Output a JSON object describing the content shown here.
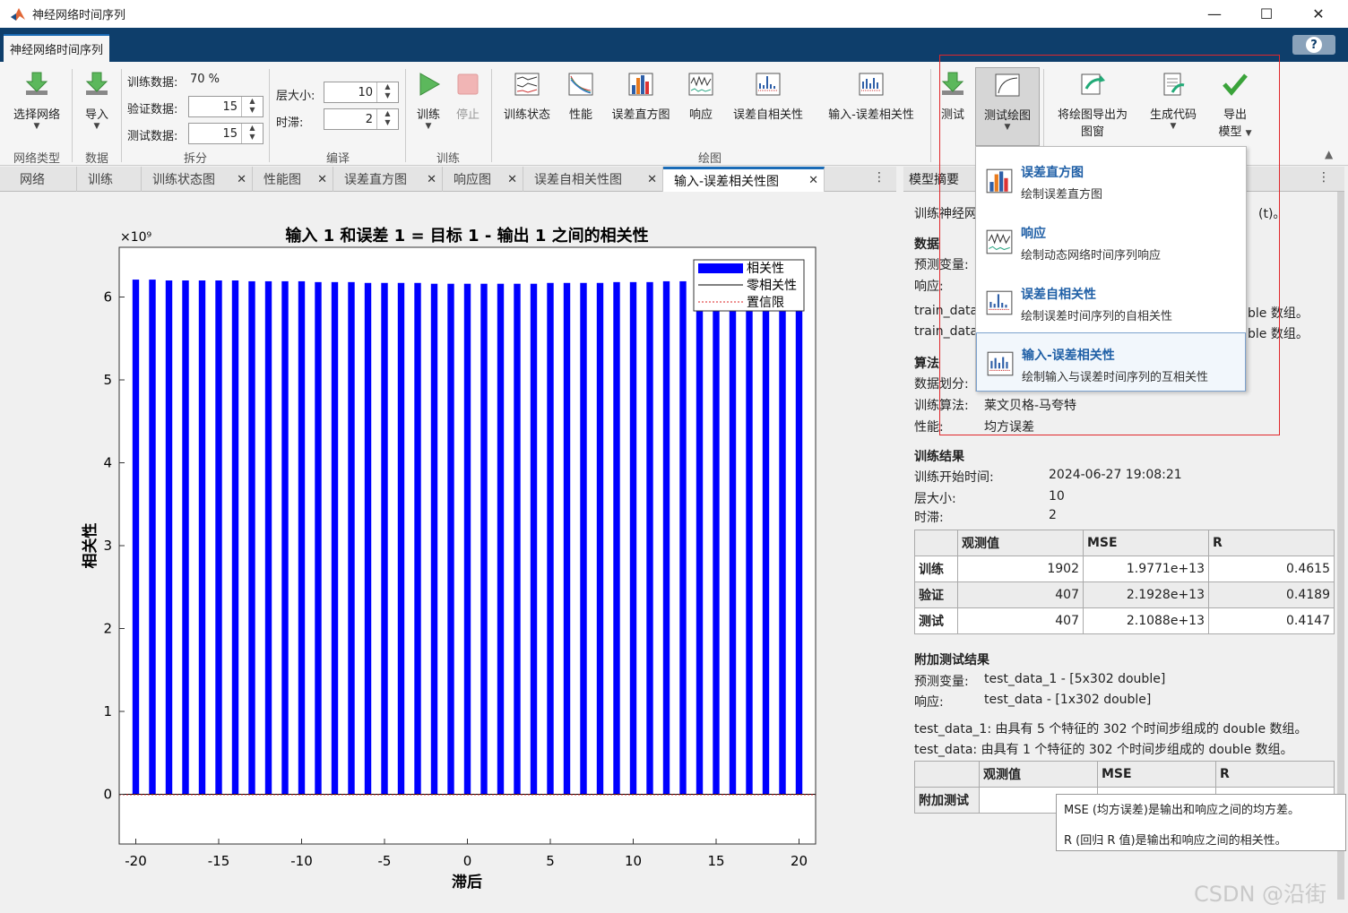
{
  "window": {
    "title": "神经网络时间序列",
    "minimize": "—",
    "maximize": "☐",
    "close": "✕"
  },
  "app_tab": "神经网络时间序列",
  "help": "?",
  "ribbon": {
    "select_network": "选择网络",
    "import": "导入",
    "network_type_group": "网络类型",
    "data_group": "数据",
    "train_data_label": "训练数据:",
    "train_data_value": "70 %",
    "val_data_label": "验证数据:",
    "val_data_value": "15",
    "test_data_label": "测试数据:",
    "test_data_value": "15",
    "split_group": "拆分",
    "layer_size_label": "层大小:",
    "layer_size_value": "10",
    "delay_label": "时滞:",
    "delay_value": "2",
    "compile_group": "编译",
    "train": "训练",
    "stop": "停止",
    "train_group": "训练",
    "train_state": "训练状态",
    "performance": "性能",
    "error_histogram": "误差直方图",
    "response": "响应",
    "error_autocorr": "误差自相关性",
    "input_error_corr": "输入-误差相关性",
    "plot_group": "绘图",
    "test": "测试",
    "test_plot": "测试绘图",
    "export_plot_1": "将绘图导出为",
    "export_plot_2": "图窗",
    "generate_code": "生成代码",
    "export_model_1": "导出",
    "export_model_2": "模型"
  },
  "doc_tabs": [
    "网络",
    "训练",
    "训练状态图",
    "性能图",
    "误差直方图",
    "响应图",
    "误差自相关性图",
    "输入-误差相关性图"
  ],
  "summary_tab": "模型摘要",
  "dropdown": [
    {
      "title": "误差直方图",
      "desc": "绘制误差直方图"
    },
    {
      "title": "响应",
      "desc": "绘制动态网络时间序列响应"
    },
    {
      "title": "误差自相关性",
      "desc": "绘制误差时间序列的自相关性"
    },
    {
      "title": "输入-误差相关性",
      "desc": "绘制输入与误差时间序列的互相关性"
    }
  ],
  "summary": {
    "intro_left": "训练神经网",
    "intro_right": "(t)。",
    "data_heading": "数据",
    "predictor_label": "预测变量:",
    "response_label": "响应:",
    "train_data_1": "train_data",
    "train_data_2": "train_data",
    "trail_1": "ble 数组。",
    "trail_2": "ble 数组。",
    "algo_heading": "算法",
    "split_label": "数据划分:",
    "algo_label": "训练算法:",
    "algo_value": "莱文贝格-马夸特",
    "perf_label": "性能:",
    "perf_value": "均方误差",
    "result_heading": "训练结果",
    "start_label": "训练开始时间:",
    "start_value": "2024-06-27 19:08:21",
    "layer_label": "层大小:",
    "layer_value": "10",
    "delay_label": "时滞:",
    "delay_value": "2",
    "table_headers": [
      "观测值",
      "MSE",
      "R"
    ],
    "table_rows": [
      {
        "name": "训练",
        "obs": "1902",
        "mse": "1.9771e+13",
        "r": "0.4615"
      },
      {
        "name": "验证",
        "obs": "407",
        "mse": "2.1928e+13",
        "r": "0.4189"
      },
      {
        "name": "测试",
        "obs": "407",
        "mse": "2.1088e+13",
        "r": "0.4147"
      }
    ],
    "extra_heading": "附加测试结果",
    "extra_predictor_label": "预测变量:",
    "extra_predictor_value": "test_data_1 - [5x302 double]",
    "extra_response_label": "响应:",
    "extra_response_value": "test_data - [1x302 double]",
    "extra_line_1": "test_data_1: 由具有 5 个特征的 302 个时间步组成的 double 数组。",
    "extra_line_2": "test_data: 由具有 1 个特征的 302 个时间步组成的 double 数组。",
    "extra_table_headers": [
      "观测值",
      "MSE",
      "R"
    ],
    "extra_row_name": "附加测试"
  },
  "tooltip": {
    "line1": "MSE (均方误差)是输出和响应之间的均方差。",
    "line2": "R (回归 R 值)是输出和响应之间的相关性。"
  },
  "watermark": "CSDN @沿街",
  "chart_data": {
    "type": "bar",
    "title": "输入 1 和误差 1 = 目标 1 - 输出 1 之间的相关性",
    "xlabel": "滞后",
    "ylabel": "相关性",
    "y_exponent": "×10⁹",
    "xlim": [
      -21,
      21
    ],
    "ylim": [
      -0.6,
      6.6
    ],
    "xticks": [
      -20,
      -15,
      -10,
      -5,
      0,
      5,
      10,
      15,
      20
    ],
    "yticks": [
      0,
      1,
      2,
      3,
      4,
      5,
      6
    ],
    "legend_position": "top-right",
    "legend": [
      "相关性",
      "零相关性",
      "置信限"
    ],
    "bar_color": "#0000ff",
    "x": [
      -20,
      -19,
      -18,
      -17,
      -16,
      -15,
      -14,
      -13,
      -12,
      -11,
      -10,
      -9,
      -8,
      -7,
      -6,
      -5,
      -4,
      -3,
      -2,
      -1,
      0,
      1,
      2,
      3,
      4,
      5,
      6,
      7,
      8,
      9,
      10,
      11,
      12,
      13,
      14,
      15,
      16,
      17,
      18,
      19,
      20
    ],
    "values": [
      6.21,
      6.21,
      6.2,
      6.2,
      6.2,
      6.2,
      6.2,
      6.19,
      6.19,
      6.19,
      6.19,
      6.18,
      6.18,
      6.18,
      6.17,
      6.17,
      6.17,
      6.17,
      6.16,
      6.16,
      6.16,
      6.16,
      6.16,
      6.16,
      6.16,
      6.17,
      6.17,
      6.17,
      6.17,
      6.18,
      6.18,
      6.18,
      6.19,
      6.19,
      6.19,
      6.19,
      6.2,
      6.2,
      6.2,
      6.21,
      6.21
    ]
  }
}
